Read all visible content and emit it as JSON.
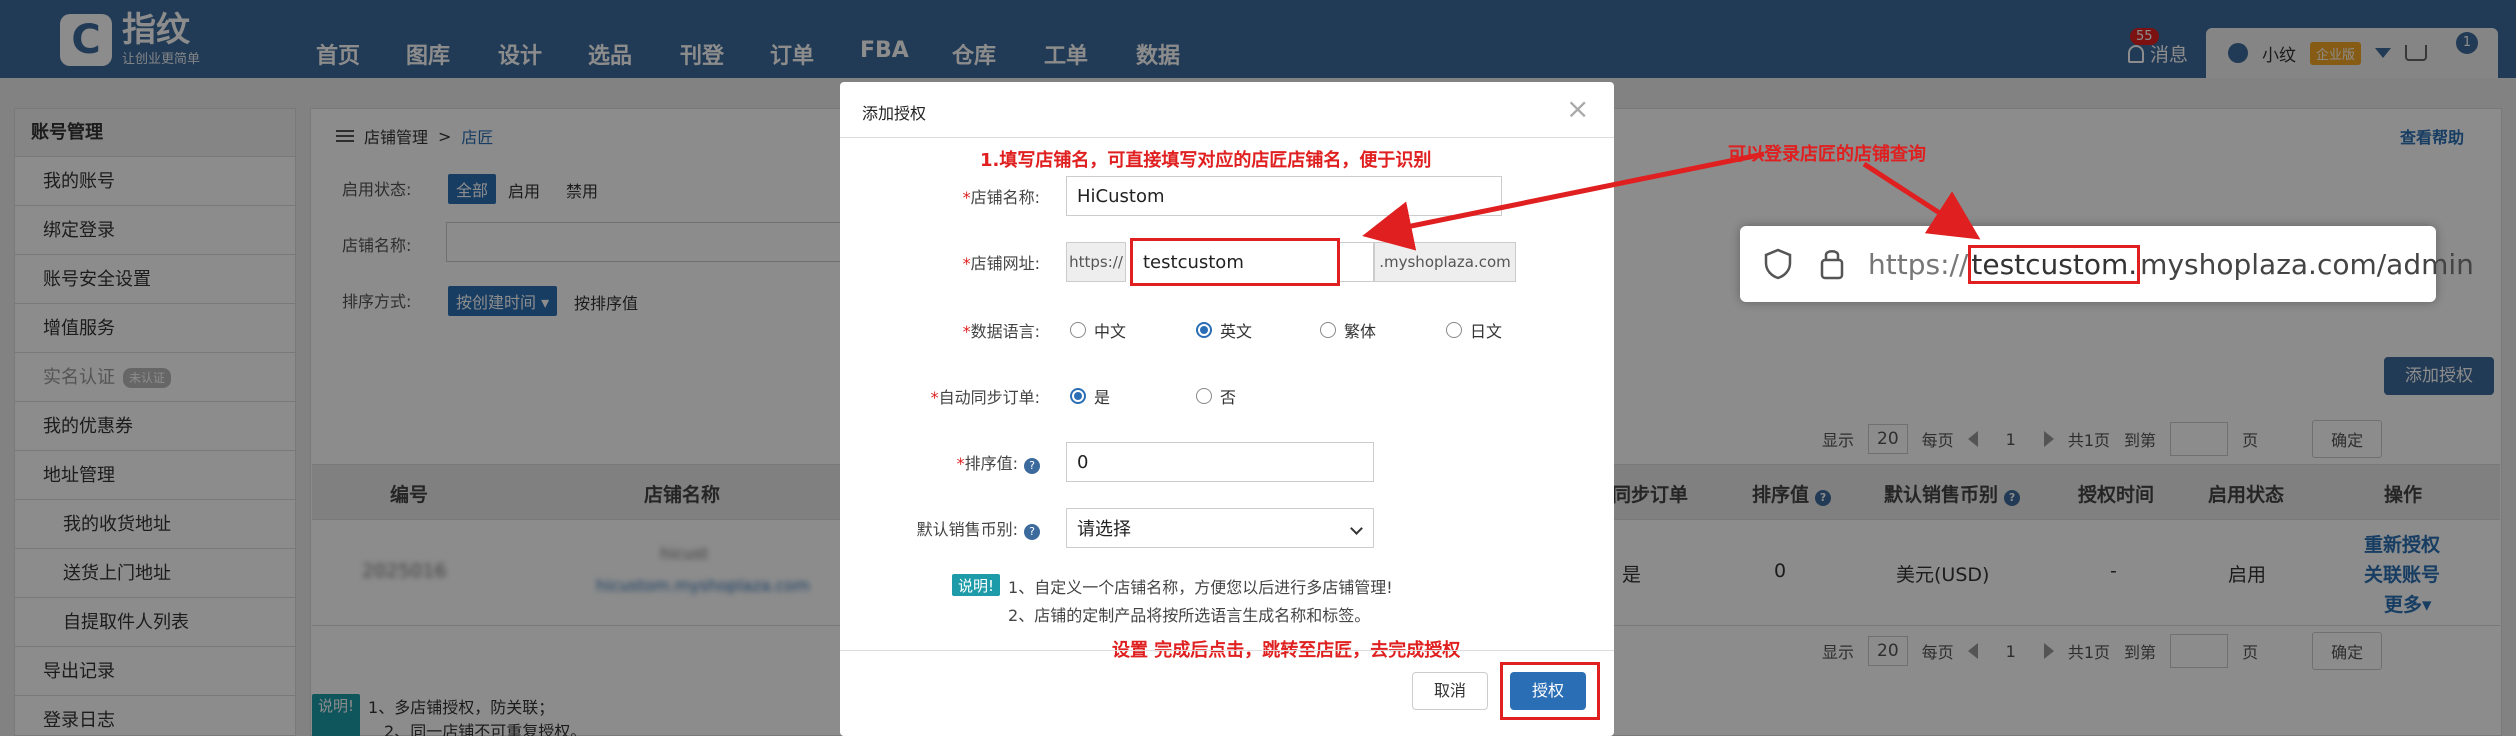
{
  "app": {
    "logo_char": "C",
    "brand": "指纹",
    "slogan": "让创业更简单",
    "nav": [
      "首页",
      "图库",
      "设计",
      "选品",
      "刊登",
      "订单",
      "FBA",
      "仓库",
      "工单",
      "数据"
    ],
    "messages_label": "消息",
    "messages_count": "55",
    "username": "小纹",
    "enterprise_badge": "企业版",
    "cart_count": "1"
  },
  "sidebar": {
    "title": "账号管理",
    "items": [
      "我的账号",
      "绑定登录",
      "账号安全设置",
      "增值服务",
      "实名认证",
      "我的优惠券",
      "地址管理",
      "我的收货地址",
      "送货上门地址",
      "自提取件人列表",
      "导出记录",
      "登录日志"
    ],
    "verify_badge": "未认证"
  },
  "page": {
    "breadcrumb_parent": "店铺管理",
    "breadcrumb_sep": ">",
    "breadcrumb_current": "店匠",
    "help": "查看帮助",
    "filter_status_label": "启用状态:",
    "filter_status_options": [
      "全部",
      "启用",
      "禁用"
    ],
    "filter_name_label": "店铺名称:",
    "sort_label": "排序方式:",
    "sort_selected": "按创建时间 ▾",
    "sort_other": "按排序值",
    "add_button": "添加授权"
  },
  "pager": {
    "show": "显示",
    "page_size": "20",
    "per_page": "每页",
    "current_page": "1",
    "total": "共1页",
    "goto": "到第",
    "page_unit": "页",
    "confirm": "确定"
  },
  "table": {
    "headers": [
      "编号",
      "店铺名称",
      "同步订单",
      "排序值",
      "默认销售币别",
      "授权时间",
      "启用状态",
      "操作"
    ],
    "row": {
      "id": "2025016",
      "store_name": "hicust",
      "store_url": "hicustom.myshoplaza.com",
      "sync": "是",
      "sort": "0",
      "currency": "美元(USD)",
      "auth_time": "-",
      "status": "启用",
      "actions": [
        "重新授权",
        "关联账号",
        "更多▾"
      ]
    }
  },
  "bottom_note": {
    "badge": "说明!",
    "lines": [
      "1、多店铺授权，防关联；",
      "2、同一店铺不可重复授权。"
    ]
  },
  "modal": {
    "title": "添加授权",
    "close": "×",
    "annotation_top": "1.填写店铺名，可直接填写对应的店匠店铺名，便于识别",
    "store_name_label": "店铺名称:",
    "store_name_value": "HiCustom",
    "store_url_label": "店铺网址:",
    "url_prefix": "https://",
    "url_value": "testcustom",
    "url_suffix": ".myshoplaza.com",
    "lang_label": "数据语言:",
    "lang_options": [
      "中文",
      "英文",
      "繁体",
      "日文"
    ],
    "lang_selected": "英文",
    "sync_label": "自动同步订单:",
    "sync_options": [
      "是",
      "否"
    ],
    "sync_selected": "是",
    "sort_label": "排序值:",
    "sort_value": "0",
    "currency_label": "默认销售币别:",
    "currency_placeholder": "请选择",
    "note_badge": "说明!",
    "note_lines": [
      "1、自定义一个店铺名称，方便您以后进行多店铺管理!",
      "2、店铺的定制产品将按所选语言生成名称和标签。"
    ],
    "annotation_bottom": "设置 完成后点击，跳转至店匠，去完成授权",
    "cancel": "取消",
    "confirm": "授权"
  },
  "annotation_right": "可以登录店匠的店铺查询",
  "browser": {
    "scheme": "https://",
    "highlight": "testcustom.",
    "rest": "myshoplaza.com/admin"
  },
  "colors": {
    "brand": "#3d6a9c",
    "accent": "#2a6fb5",
    "annotation": "#e02020",
    "note": "#1d9ba8"
  }
}
